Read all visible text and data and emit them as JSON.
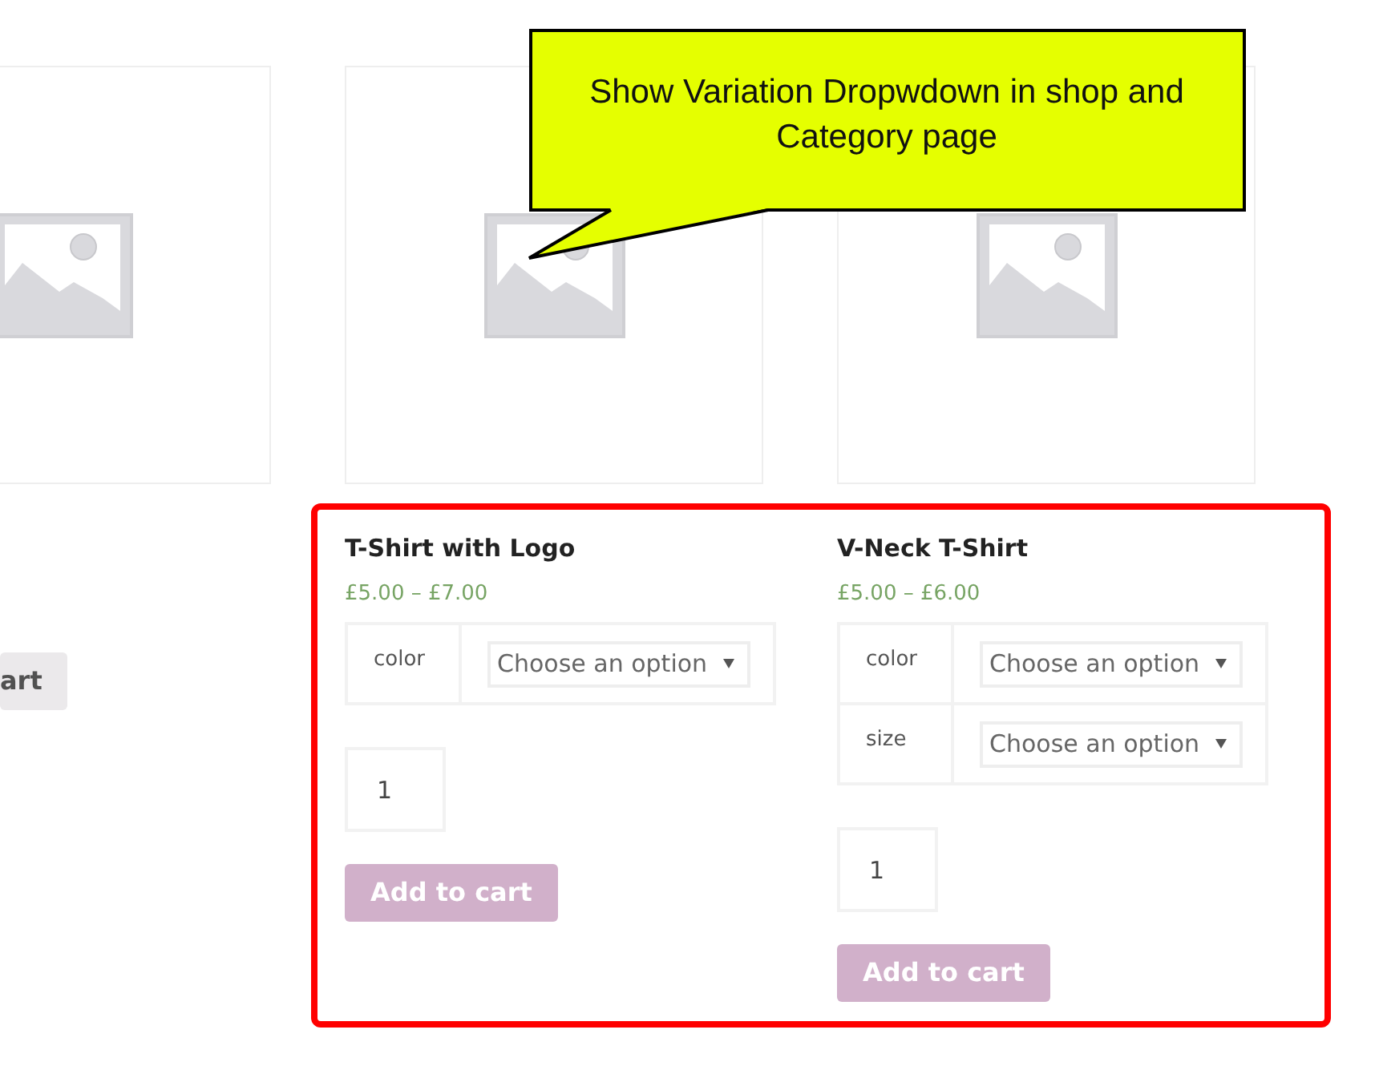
{
  "products": [
    {
      "kind": "simple",
      "button": {
        "label": "art",
        "kind": "default"
      }
    },
    {
      "kind": "variable",
      "title": "T-Shirt with Logo",
      "price": "£5.00 – £7.00",
      "attributes": [
        {
          "label": "color",
          "placeholder": "Choose an option"
        }
      ],
      "quantity": "1",
      "button": {
        "label": "Add to cart",
        "kind": "alt",
        "disabled": true
      }
    },
    {
      "kind": "variable",
      "title": "V-Neck T-Shirt",
      "price": "£5.00 – £6.00",
      "attributes": [
        {
          "label": "color",
          "placeholder": "Choose an option"
        },
        {
          "label": "size",
          "placeholder": "Choose an option"
        }
      ],
      "quantity": "1",
      "button": {
        "label": "Add to cart",
        "kind": "alt",
        "disabled": true
      }
    }
  ],
  "callout": {
    "text": "Show Variation Dropwdown in shop and Category page"
  }
}
